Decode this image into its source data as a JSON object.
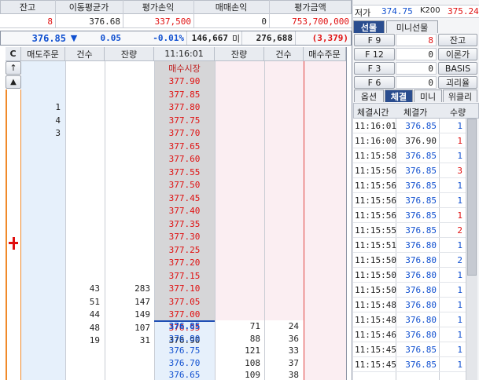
{
  "summary": {
    "headers": [
      "잔고",
      "이동평균가",
      "평가손익",
      "매매손익",
      "평가금액"
    ],
    "values": [
      "8",
      "376.68",
      "337,500",
      "0",
      "753,700,000"
    ]
  },
  "quote_bar": {
    "price": "376.85",
    "direction_icon": "▼",
    "change": "0.05",
    "change_pct": "-0.01%",
    "volume": "146,667",
    "volume_unit": "미",
    "open_interest": "276,688",
    "oi_change": "(3,379)"
  },
  "book": {
    "headers": [
      "C",
      "매도주문",
      "건수",
      "잔량",
      "11:16:01",
      "잔량",
      "건수",
      "매수주문"
    ],
    "market_label": "매수시장",
    "sell_rows": [
      {
        "order": "",
        "count": "",
        "qty": "",
        "price": "377.90"
      },
      {
        "order": "",
        "count": "",
        "qty": "",
        "price": "377.85"
      },
      {
        "order": "1",
        "count": "",
        "qty": "",
        "price": "377.80"
      },
      {
        "order": "4",
        "count": "",
        "qty": "",
        "price": "377.75"
      },
      {
        "order": "3",
        "count": "",
        "qty": "",
        "price": "377.70"
      },
      {
        "order": "",
        "count": "",
        "qty": "",
        "price": "377.65"
      },
      {
        "order": "",
        "count": "",
        "qty": "",
        "price": "377.60"
      },
      {
        "order": "",
        "count": "",
        "qty": "",
        "price": "377.55"
      },
      {
        "order": "",
        "count": "",
        "qty": "",
        "price": "377.50"
      },
      {
        "order": "",
        "count": "",
        "qty": "",
        "price": "377.45"
      },
      {
        "order": "",
        "count": "",
        "qty": "",
        "price": "377.40"
      },
      {
        "order": "",
        "count": "",
        "qty": "",
        "price": "377.35"
      },
      {
        "order": "",
        "count": "",
        "qty": "",
        "price": "377.30"
      },
      {
        "order": "",
        "count": "",
        "qty": "",
        "price": "377.25"
      },
      {
        "order": "",
        "count": "",
        "qty": "",
        "price": "377.20"
      },
      {
        "order": "",
        "count": "",
        "qty": "",
        "price": "377.15"
      },
      {
        "order": "",
        "count": "43",
        "qty": "283",
        "price": "377.10"
      },
      {
        "order": "",
        "count": "51",
        "qty": "147",
        "price": "377.05"
      },
      {
        "order": "",
        "count": "44",
        "qty": "149",
        "price": "377.00"
      },
      {
        "order": "",
        "count": "48",
        "qty": "107",
        "price": "376.95"
      },
      {
        "order": "",
        "count": "19",
        "qty": "31",
        "price": "376.90"
      }
    ],
    "buy_rows": [
      {
        "price": "376.85",
        "qty": "71",
        "count": "24"
      },
      {
        "price": "376.80",
        "qty": "88",
        "count": "36"
      },
      {
        "price": "376.75",
        "qty": "121",
        "count": "33"
      },
      {
        "price": "376.70",
        "qty": "108",
        "count": "37"
      },
      {
        "price": "376.65",
        "qty": "109",
        "count": "38"
      }
    ]
  },
  "right_top": {
    "rows": [
      {
        "label": "저가",
        "value": "374.75",
        "label2": "K200",
        "value2": "375.24"
      }
    ]
  },
  "futures_tabs": [
    "선물",
    "미니선물"
  ],
  "futures": [
    {
      "label": "F 9",
      "value": "8",
      "button": "잔고"
    },
    {
      "label": "F 12",
      "value": "0",
      "button": "이론가"
    },
    {
      "label": "F 3",
      "value": "0",
      "button": "BASIS"
    },
    {
      "label": "F 6",
      "value": "0",
      "button": "괴리율"
    }
  ],
  "trade_tabs": [
    "옵션",
    "체결",
    "미니",
    "위클리"
  ],
  "trades": {
    "headers": [
      "체결시간",
      "체결가",
      "수량"
    ],
    "rows": [
      {
        "time": "11:16:01",
        "price": "376.85",
        "qty": "1",
        "side": "buy"
      },
      {
        "time": "11:16:00",
        "price": "376.90",
        "qty": "1",
        "side": "sell"
      },
      {
        "time": "11:15:58",
        "price": "376.85",
        "qty": "1",
        "side": "buy"
      },
      {
        "time": "11:15:56",
        "price": "376.85",
        "qty": "3",
        "side": "sell"
      },
      {
        "time": "11:15:56",
        "price": "376.85",
        "qty": "1",
        "side": "buy"
      },
      {
        "time": "11:15:56",
        "price": "376.85",
        "qty": "1",
        "side": "buy"
      },
      {
        "time": "11:15:56",
        "price": "376.85",
        "qty": "1",
        "side": "sell"
      },
      {
        "time": "11:15:55",
        "price": "376.85",
        "qty": "2",
        "side": "sell"
      },
      {
        "time": "11:15:51",
        "price": "376.80",
        "qty": "1",
        "side": "buy"
      },
      {
        "time": "11:15:50",
        "price": "376.80",
        "qty": "2",
        "side": "buy"
      },
      {
        "time": "11:15:50",
        "price": "376.80",
        "qty": "1",
        "side": "buy"
      },
      {
        "time": "11:15:50",
        "price": "376.80",
        "qty": "1",
        "side": "buy"
      },
      {
        "time": "11:15:48",
        "price": "376.80",
        "qty": "1",
        "side": "buy"
      },
      {
        "time": "11:15:48",
        "price": "376.80",
        "qty": "1",
        "side": "buy"
      },
      {
        "time": "11:15:46",
        "price": "376.80",
        "qty": "1",
        "side": "buy"
      },
      {
        "time": "11:15:45",
        "price": "376.85",
        "qty": "1",
        "side": "buy"
      },
      {
        "time": "11:15:45",
        "price": "376.85",
        "qty": "1",
        "side": "buy"
      }
    ]
  },
  "colors": {
    "up": "#e01010",
    "down": "#1050d0",
    "header_bg": "#e8ebf0"
  }
}
